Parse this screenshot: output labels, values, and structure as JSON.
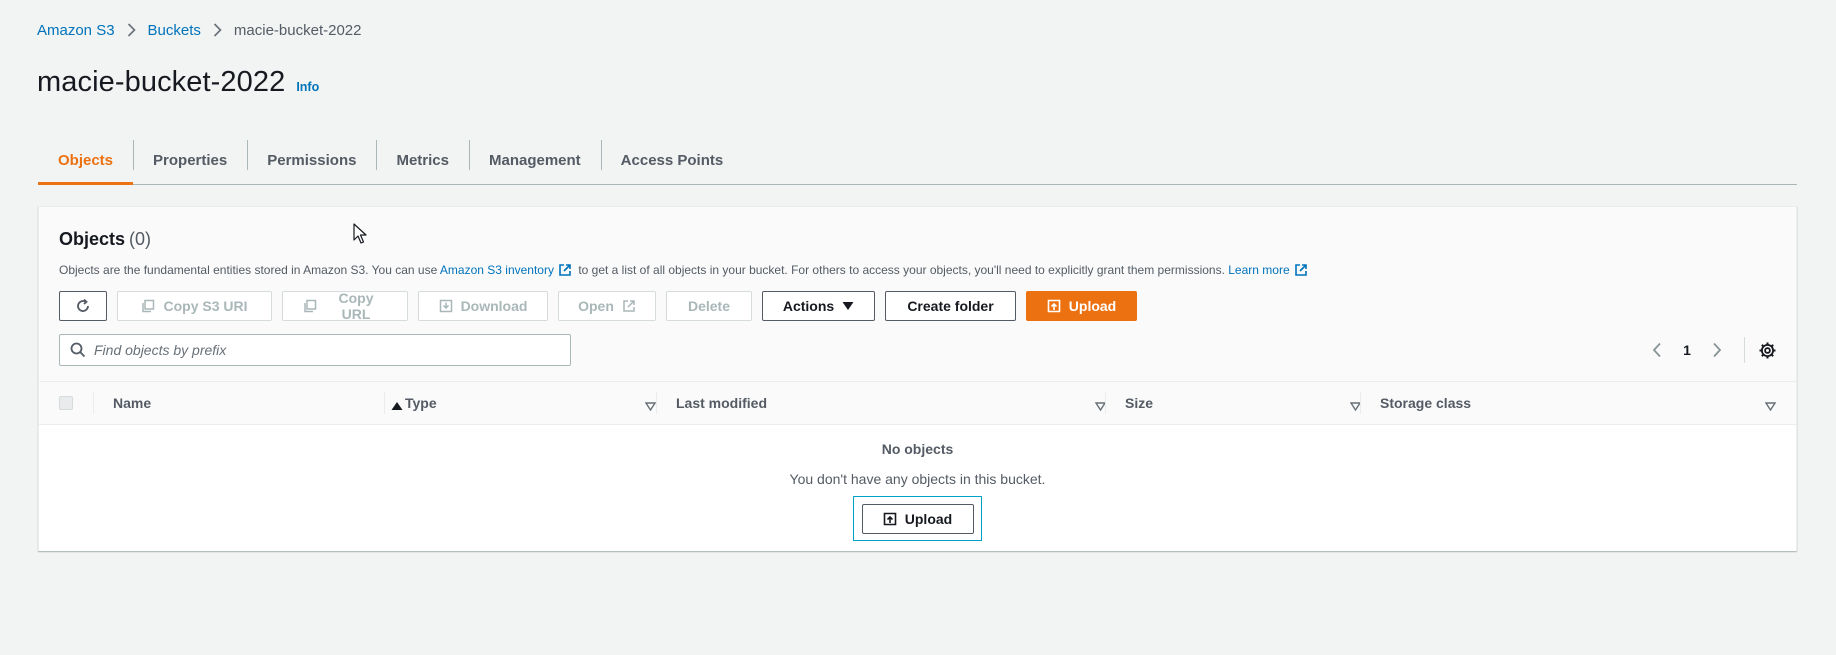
{
  "breadcrumb": {
    "items": [
      "Amazon S3",
      "Buckets"
    ],
    "current": "macie-bucket-2022"
  },
  "header": {
    "title": "macie-bucket-2022",
    "info_label": "Info"
  },
  "tabs": [
    {
      "label": "Objects",
      "active": true
    },
    {
      "label": "Properties"
    },
    {
      "label": "Permissions"
    },
    {
      "label": "Metrics"
    },
    {
      "label": "Management"
    },
    {
      "label": "Access Points"
    }
  ],
  "objects_panel": {
    "title": "Objects",
    "count": "(0)",
    "desc_part1": "Objects are the fundamental entities stored in Amazon S3. You can use ",
    "inventory_link": "Amazon S3 inventory",
    "desc_part2": " to get a list of all objects in your bucket. For others to access your objects, you'll need to explicitly grant them permissions. ",
    "learn_more": "Learn more",
    "toolbar": {
      "copy_s3_uri": "Copy S3 URI",
      "copy_url": "Copy URL",
      "download": "Download",
      "open": "Open",
      "delete": "Delete",
      "actions": "Actions",
      "create_folder": "Create folder",
      "upload": "Upload"
    },
    "search": {
      "placeholder": "Find objects by prefix",
      "value": ""
    },
    "pagination": {
      "current_page": "1"
    },
    "columns": [
      "Name",
      "Type",
      "Last modified",
      "Size",
      "Storage class"
    ],
    "empty_state": {
      "title": "No objects",
      "description": "You don't have any objects in this bucket.",
      "upload_label": "Upload"
    }
  },
  "colors": {
    "accent": "#ec7211",
    "link": "#0073bb",
    "focus": "#00a1c9"
  }
}
